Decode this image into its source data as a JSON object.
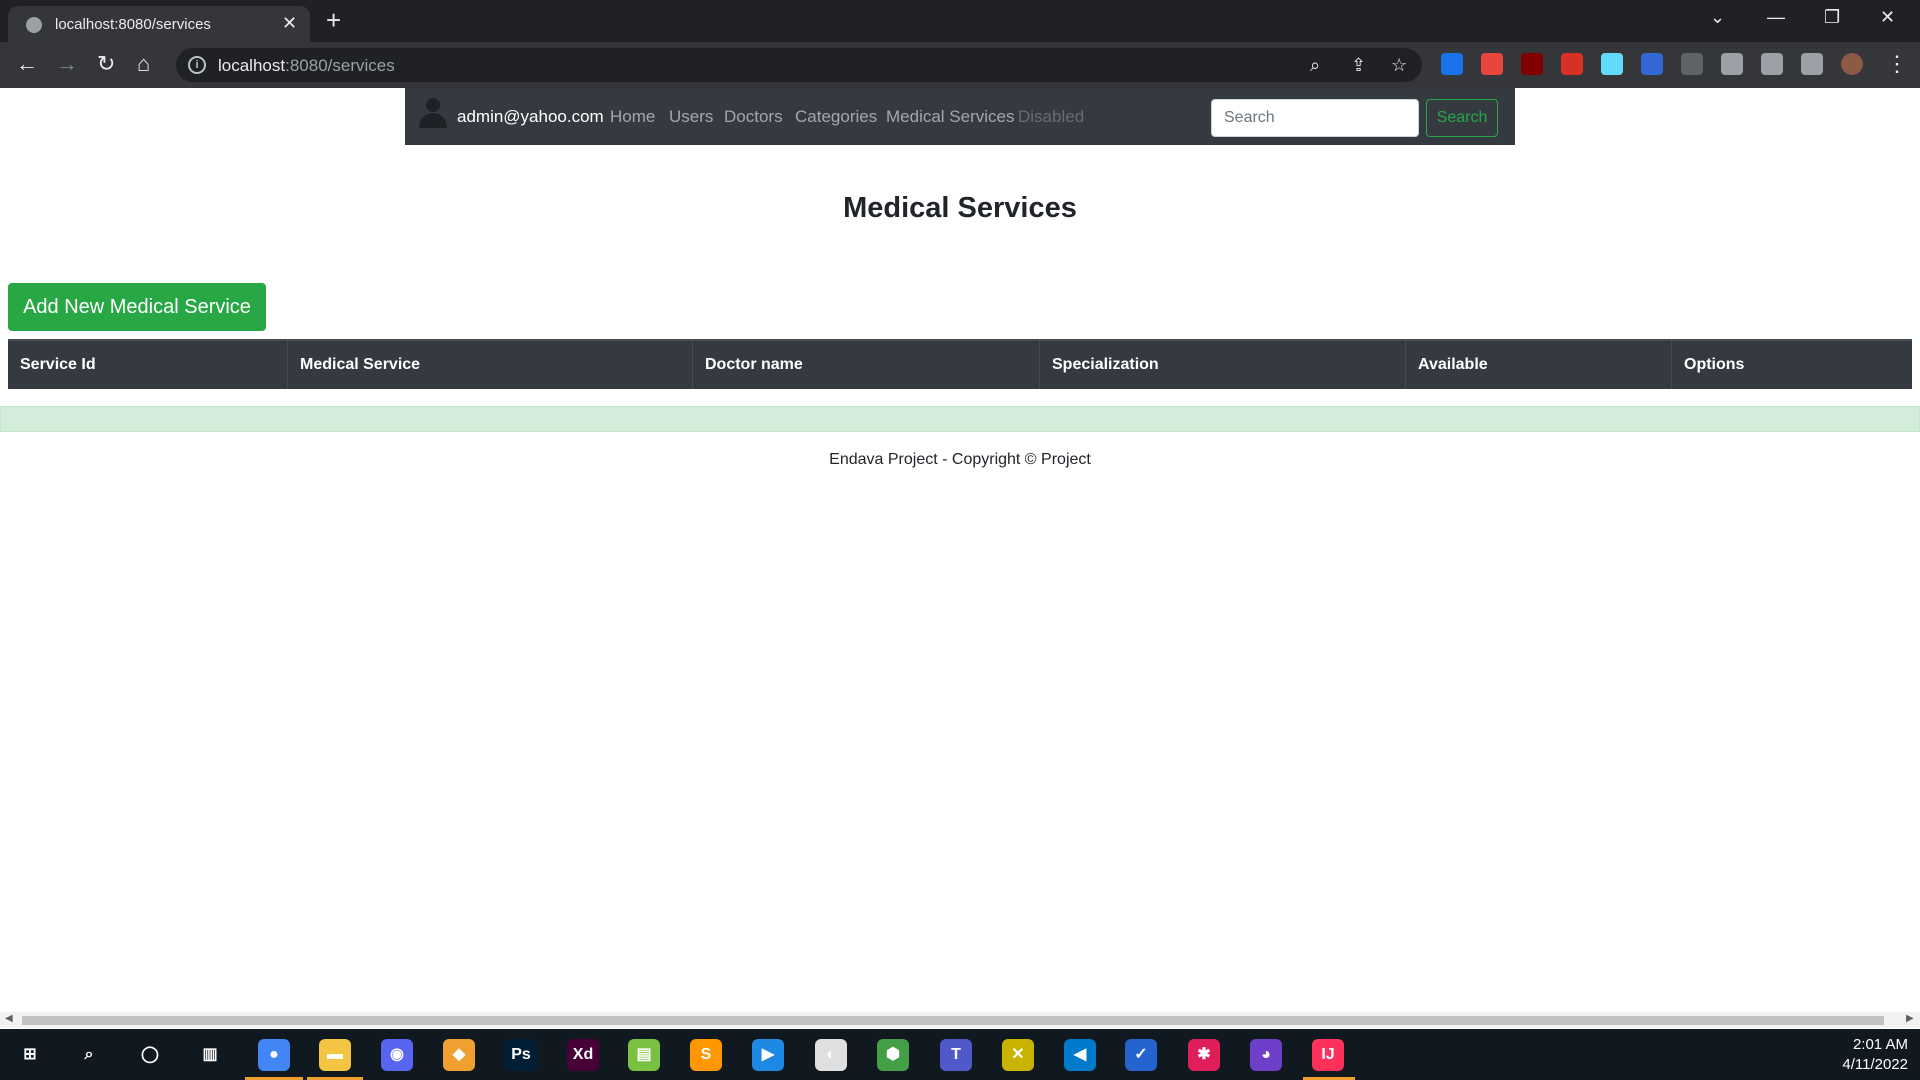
{
  "browser": {
    "tab_title": "localhost:8080/services",
    "tab_close": "✕",
    "new_tab": "+",
    "url_host": "localhost",
    "url_path": ":8080/services",
    "info_glyph": "i",
    "back_glyph": "←",
    "forward_glyph": "→",
    "reload_glyph": "↻",
    "home_glyph": "⌂",
    "zoom_glyph": "⌕",
    "share_glyph": "⇪",
    "star_glyph": "☆",
    "menu_glyph": "⋮",
    "dropdown_glyph": "⌄",
    "minimize_glyph": "—",
    "restore_glyph": "❐",
    "close_glyph": "✕",
    "extensions": [
      {
        "icon": "grammarly-icon",
        "color": "#1a73e8"
      },
      {
        "icon": "extension-icon",
        "color": "#e8453c"
      },
      {
        "icon": "ublock-icon",
        "color": "#800000"
      },
      {
        "icon": "pdf-icon",
        "color": "#d93025"
      },
      {
        "icon": "react-devtools-icon",
        "color": "#61dafb"
      },
      {
        "icon": "screen-recorder-icon",
        "color": "#3367d6"
      },
      {
        "icon": "pen-icon",
        "color": "#5f6368"
      },
      {
        "icon": "puzzle-icon",
        "color": "#9aa0a6"
      },
      {
        "icon": "reading-list-icon",
        "color": "#9aa0a6"
      },
      {
        "icon": "side-panel-icon",
        "color": "#9aa0a6"
      },
      {
        "icon": "profile-avatar",
        "color": "#8a5a44"
      }
    ]
  },
  "navbar": {
    "user_email": "admin@yahoo.com",
    "links": [
      "Home",
      "Users",
      "Doctors",
      "Categories",
      "Medical Services"
    ],
    "disabled_link": "Disabled",
    "search_placeholder": "Search",
    "search_button": "Search"
  },
  "main": {
    "title": "Medical Services",
    "add_button": "Add New Medical Service",
    "table": {
      "columns": [
        "Service Id",
        "Medical Service",
        "Doctor name",
        "Specialization",
        "Available",
        "Options"
      ],
      "rows": []
    }
  },
  "footer": {
    "text": "Endava Project - Copyright © Project"
  },
  "taskbar": {
    "apps": [
      {
        "name": "start-icon",
        "color": "#101820",
        "label": "⊞"
      },
      {
        "name": "search-icon",
        "color": "#101820",
        "label": "⌕"
      },
      {
        "name": "cortana-icon",
        "color": "#101820",
        "label": "◯"
      },
      {
        "name": "task-view-icon",
        "color": "#101820",
        "label": "▥"
      },
      {
        "name": "chrome-icon",
        "color": "#4285f4",
        "label": "●"
      },
      {
        "name": "file-explorer-icon",
        "color": "#f4c542",
        "label": "▬"
      },
      {
        "name": "discord-icon",
        "color": "#5865f2",
        "label": "◉"
      },
      {
        "name": "git-icon",
        "color": "#f0a030",
        "label": "◆"
      },
      {
        "name": "photoshop-icon",
        "color": "#001e36",
        "label": "Ps"
      },
      {
        "name": "xd-icon",
        "color": "#470137",
        "label": "Xd"
      },
      {
        "name": "notepad-icon",
        "color": "#7ac142",
        "label": "▤"
      },
      {
        "name": "sublime-icon",
        "color": "#ff9800",
        "label": "S"
      },
      {
        "name": "media-player-icon",
        "color": "#1e88e5",
        "label": "▶"
      },
      {
        "name": "mysql-workbench-icon",
        "color": "#e0e0e0",
        "label": "◐"
      },
      {
        "name": "node-icon",
        "color": "#43a047",
        "label": "⬢"
      },
      {
        "name": "teams-icon",
        "color": "#5059c9",
        "label": "T"
      },
      {
        "name": "tool-icon",
        "color": "#c8b400",
        "label": "✕"
      },
      {
        "name": "vscode-icon",
        "color": "#007acc",
        "label": "◀"
      },
      {
        "name": "todo-icon",
        "color": "#2564cf",
        "label": "✓"
      },
      {
        "name": "slack-icon",
        "color": "#e01e5a",
        "label": "✱"
      },
      {
        "name": "github-desktop-icon",
        "color": "#6e40c9",
        "label": "◕"
      },
      {
        "name": "intellij-icon",
        "color": "#fe315d",
        "label": "IJ"
      }
    ],
    "time": "2:01 AM",
    "date": "4/11/2022"
  }
}
